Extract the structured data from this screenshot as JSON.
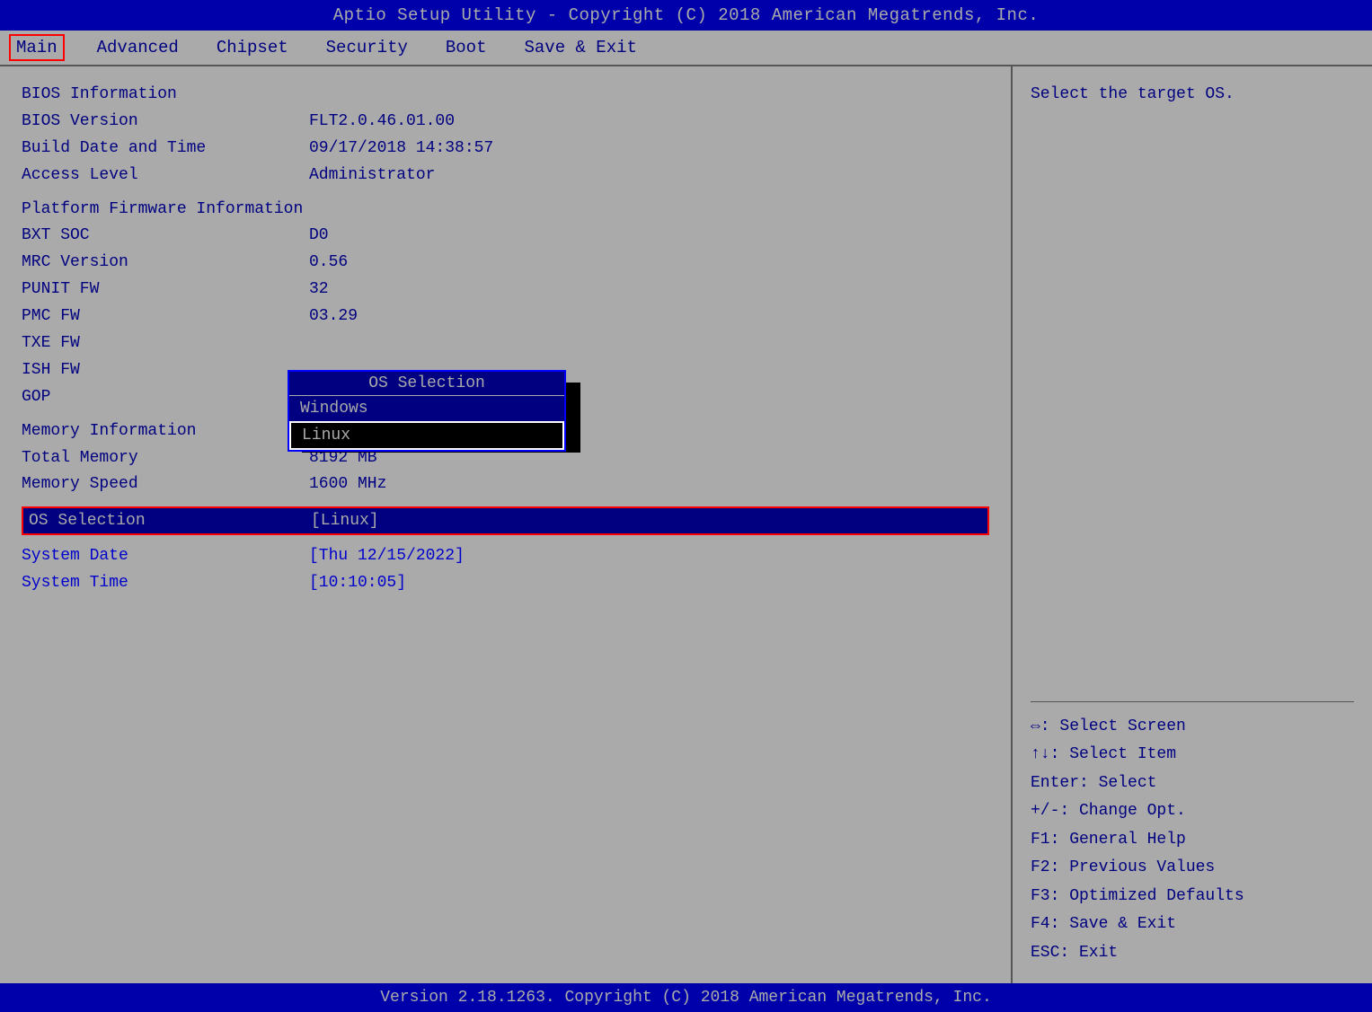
{
  "title": "Aptio Setup Utility - Copyright (C) 2018 American Megatrends, Inc.",
  "footer": "Version 2.18.1263. Copyright (C) 2018 American Megatrends, Inc.",
  "menu": {
    "items": [
      {
        "label": "Main",
        "active": true
      },
      {
        "label": "Advanced",
        "active": false
      },
      {
        "label": "Chipset",
        "active": false
      },
      {
        "label": "Security",
        "active": false
      },
      {
        "label": "Boot",
        "active": false
      },
      {
        "label": "Save & Exit",
        "active": false
      }
    ]
  },
  "bios_info": {
    "section_label": "BIOS Information",
    "version_label": "BIOS Version",
    "version_value": "FLT2.0.46.01.00",
    "build_date_label": "Build Date and Time",
    "build_date_value": "09/17/2018 14:38:57",
    "access_level_label": "Access Level",
    "access_level_value": "Administrator"
  },
  "platform_info": {
    "section_label": "Platform Firmware Information",
    "bxt_soc_label": "BXT SOC",
    "bxt_soc_value": "D0",
    "mrc_version_label": "MRC Version",
    "mrc_version_value": "0.56",
    "punit_fw_label": "PUNIT FW",
    "punit_fw_value": "32",
    "pmc_fw_label": "PMC FW",
    "pmc_fw_value": "03.29",
    "txe_fw_label": "TXE FW",
    "txe_fw_value": "",
    "ish_fw_label": "ISH FW",
    "ish_fw_value": "",
    "gop_label": "GOP",
    "gop_value": ""
  },
  "memory_info": {
    "section_label": "Memory Information",
    "total_memory_label": "Total Memory",
    "total_memory_value": "8192 MB",
    "memory_speed_label": "Memory Speed",
    "memory_speed_value": "1600 MHz"
  },
  "os_selection": {
    "label": "OS Selection",
    "value": "[Linux]"
  },
  "system_date": {
    "label": "System Date",
    "value": "[Thu 12/15/2022]"
  },
  "system_time": {
    "label": "System Time",
    "value": "[10:10:05]"
  },
  "os_popup": {
    "title": "OS Selection",
    "items": [
      {
        "label": "Windows",
        "selected": false
      },
      {
        "label": "Linux",
        "selected": true
      }
    ]
  },
  "help": {
    "description": "Select the target OS.",
    "keys": [
      "⇔: Select Screen",
      "↑↓: Select Item",
      "Enter: Select",
      "+/-: Change Opt.",
      "F1: General Help",
      "F2: Previous Values",
      "F3: Optimized Defaults",
      "F4: Save & Exit",
      "ESC: Exit"
    ]
  }
}
